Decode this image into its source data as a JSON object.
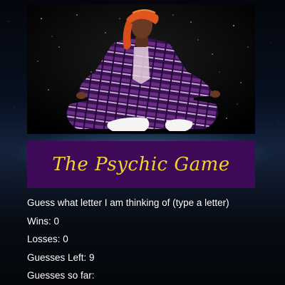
{
  "game": {
    "title": "The Psychic Game",
    "prompt": "Guess what letter I am thinking of (type a letter)",
    "wins_label": "Wins: ",
    "wins": "0",
    "losses_label": "Losses: ",
    "losses": "0",
    "guesses_left_label": "Guesses Left: ",
    "guesses_left": "9",
    "guesses_so_far_label": "Guesses so far: ",
    "guesses_so_far": ""
  },
  "colors": {
    "banner_background": "#3e0a58",
    "title_text": "#f2d230",
    "body_text": "#ffffff"
  }
}
